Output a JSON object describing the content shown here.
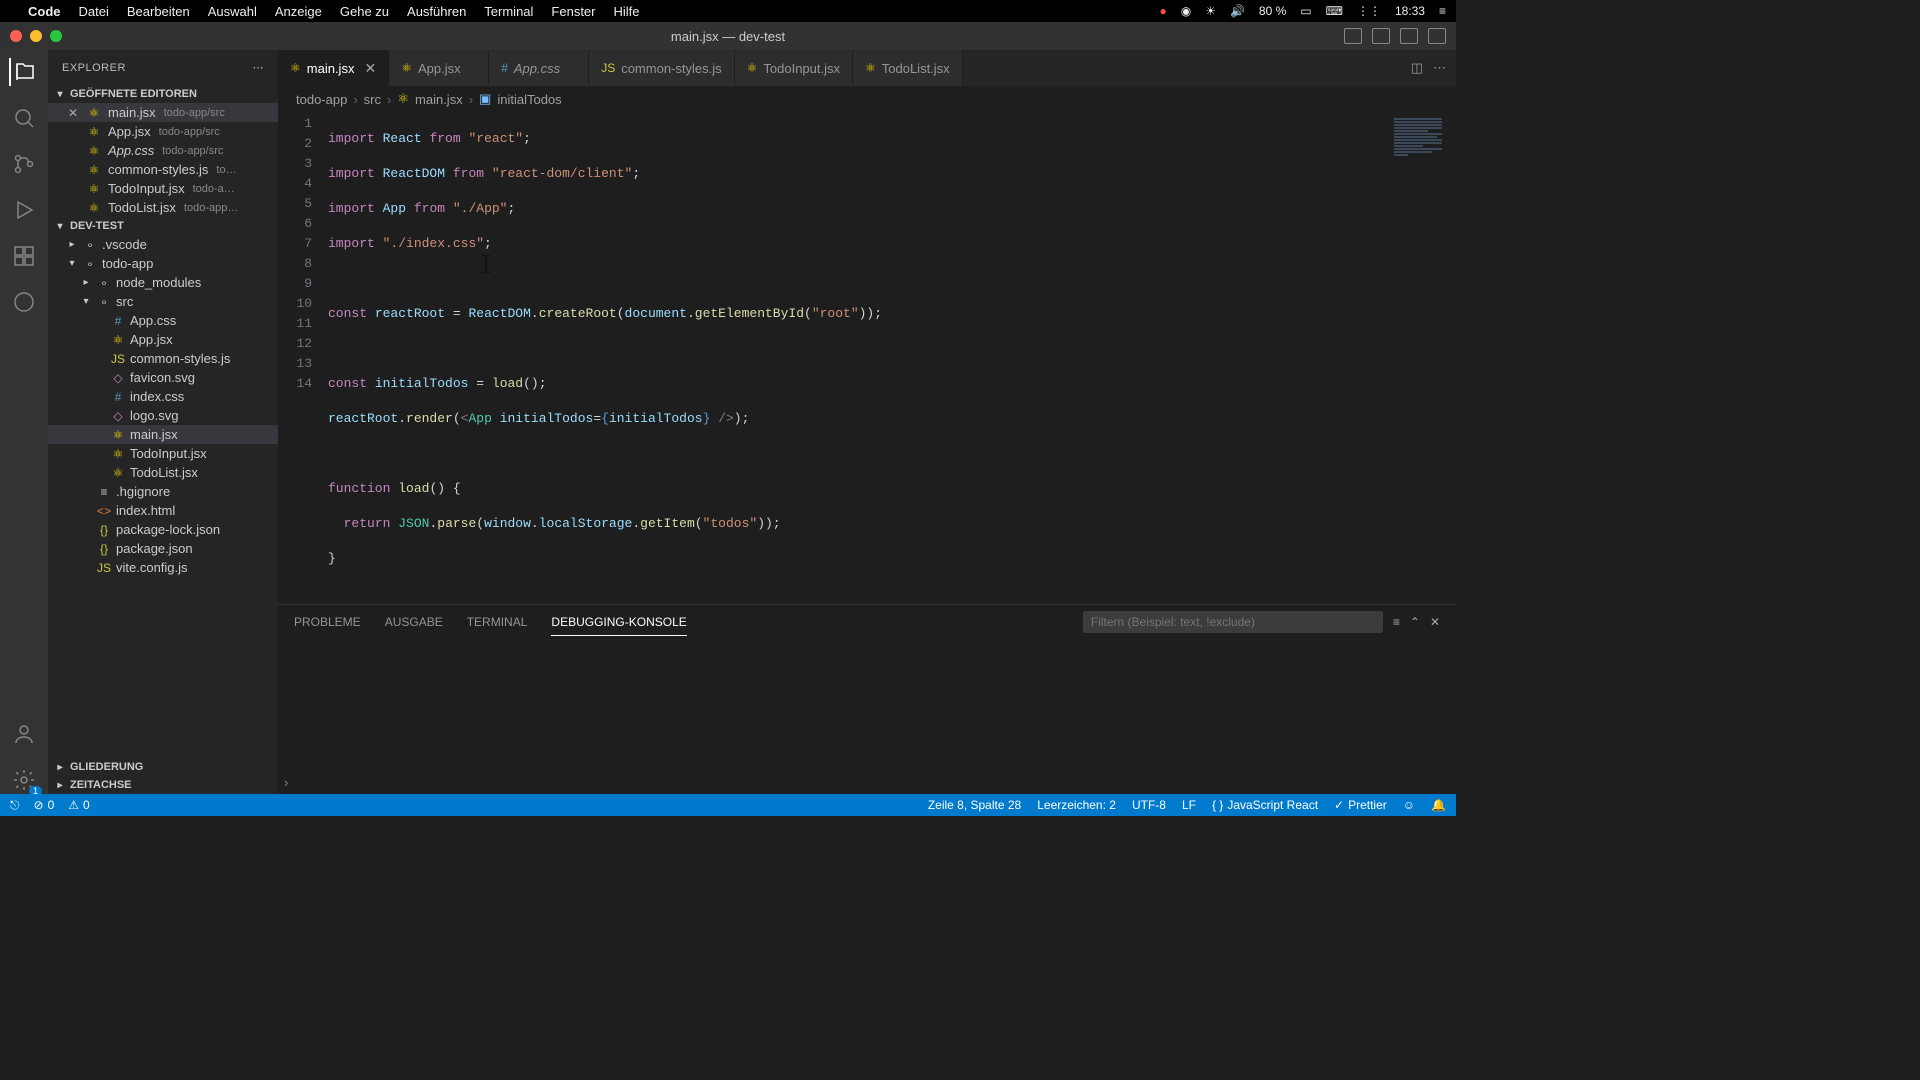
{
  "macbar": {
    "app": "Code",
    "menus": [
      "Datei",
      "Bearbeiten",
      "Auswahl",
      "Anzeige",
      "Gehe zu",
      "Ausführen",
      "Terminal",
      "Fenster",
      "Hilfe"
    ],
    "battery": "80 %",
    "time": "18:33"
  },
  "window": {
    "title": "main.jsx — dev-test"
  },
  "sidebar": {
    "title": "EXPLORER",
    "sections": {
      "openEditors": "GEÖFFNETE EDITOREN",
      "project": "DEV-TEST",
      "outline": "GLIEDERUNG",
      "timeline": "ZEITACHSE"
    },
    "openEditors": [
      {
        "name": "main.jsx",
        "path": "todo-app/src",
        "active": true
      },
      {
        "name": "App.jsx",
        "path": "todo-app/src"
      },
      {
        "name": "App.css",
        "path": "todo-app/src",
        "italic": true
      },
      {
        "name": "common-styles.js",
        "path": "to…"
      },
      {
        "name": "TodoInput.jsx",
        "path": "todo-a…"
      },
      {
        "name": "TodoList.jsx",
        "path": "todo-app…"
      }
    ],
    "tree": [
      {
        "label": ".vscode",
        "indent": 1,
        "type": "folder",
        "open": false
      },
      {
        "label": "todo-app",
        "indent": 1,
        "type": "folder",
        "open": true
      },
      {
        "label": "node_modules",
        "indent": 2,
        "type": "folder",
        "open": false
      },
      {
        "label": "src",
        "indent": 2,
        "type": "folder",
        "open": true
      },
      {
        "label": "App.css",
        "indent": 3,
        "type": "css"
      },
      {
        "label": "App.jsx",
        "indent": 3,
        "type": "react"
      },
      {
        "label": "common-styles.js",
        "indent": 3,
        "type": "js"
      },
      {
        "label": "favicon.svg",
        "indent": 3,
        "type": "svg"
      },
      {
        "label": "index.css",
        "indent": 3,
        "type": "css"
      },
      {
        "label": "logo.svg",
        "indent": 3,
        "type": "svg"
      },
      {
        "label": "main.jsx",
        "indent": 3,
        "type": "react",
        "selected": true
      },
      {
        "label": "TodoInput.jsx",
        "indent": 3,
        "type": "react"
      },
      {
        "label": "TodoList.jsx",
        "indent": 3,
        "type": "react"
      },
      {
        "label": ".hgignore",
        "indent": 2,
        "type": "file"
      },
      {
        "label": "index.html",
        "indent": 2,
        "type": "html"
      },
      {
        "label": "package-lock.json",
        "indent": 2,
        "type": "json"
      },
      {
        "label": "package.json",
        "indent": 2,
        "type": "json"
      },
      {
        "label": "vite.config.js",
        "indent": 2,
        "type": "js"
      }
    ]
  },
  "tabs": [
    {
      "label": "main.jsx",
      "active": true,
      "type": "react"
    },
    {
      "label": "App.jsx",
      "type": "react"
    },
    {
      "label": "App.css",
      "type": "css",
      "italic": true
    },
    {
      "label": "common-styles.js",
      "type": "js"
    },
    {
      "label": "TodoInput.jsx",
      "type": "react"
    },
    {
      "label": "TodoList.jsx",
      "type": "react"
    }
  ],
  "breadcrumbs": [
    "todo-app",
    "src",
    "main.jsx",
    "initialTodos"
  ],
  "code": {
    "lineCount": 13
  },
  "panel": {
    "tabs": [
      "PROBLEME",
      "AUSGABE",
      "TERMINAL",
      "DEBUGGING-KONSOLE"
    ],
    "activeTab": 3,
    "filterPlaceholder": "Filtern (Beispiel: text, !exclude)"
  },
  "statusbar": {
    "errors": "0",
    "warnings": "0",
    "cursor": "Zeile 8, Spalte 28",
    "indent": "Leerzeichen: 2",
    "encoding": "UTF-8",
    "eol": "LF",
    "language": "JavaScript React",
    "prettier": "Prettier"
  }
}
